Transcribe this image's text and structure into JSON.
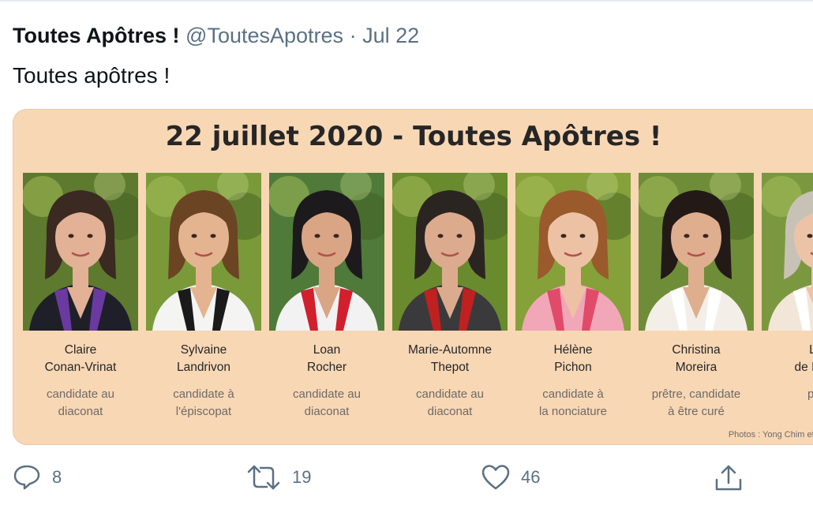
{
  "tweet": {
    "author_name": "Toutes Apôtres !",
    "author_handle": "@ToutesApotres",
    "separator": "·",
    "date": "Jul 22",
    "text": "Toutes apôtres !"
  },
  "card": {
    "title": "22 juillet 2020 - Toutes Apôtres !",
    "photo_credit": "Photos : Yong Chim et Lo",
    "people": [
      {
        "name": "Claire\nConan-Vrinat",
        "role": "candidate au\ndiaconat",
        "hair": "#3a2a22",
        "skin": "#e2b196",
        "shirt": "#1f1f2a",
        "accent": "#6a3aa0",
        "bg": "#5e7a2e"
      },
      {
        "name": "Sylvaine\nLandrivon",
        "role": "candidate à\nl'épiscopat",
        "hair": "#6b4424",
        "skin": "#e3b48f",
        "shirt": "#f4f4f2",
        "accent": "#1a1a1a",
        "bg": "#7a9a3a"
      },
      {
        "name": "Loan\nRocher",
        "role": "candidate au\ndiaconat",
        "hair": "#1c1a1c",
        "skin": "#d9a585",
        "shirt": "#f2f2f2",
        "accent": "#d21f2e",
        "bg": "#4f7a3a"
      },
      {
        "name": "Marie-Automne\nThepot",
        "role": "candidate au\ndiaconat",
        "hair": "#2b2522",
        "skin": "#dcab8e",
        "shirt": "#3a3a3c",
        "accent": "#c02020",
        "bg": "#6a8a2e"
      },
      {
        "name": "Hélène\nPichon",
        "role": "candidate à\nla nonciature",
        "hair": "#9a5a2c",
        "skin": "#edc2a4",
        "shirt": "#f2a7b8",
        "accent": "#e24a6a",
        "bg": "#86a03a"
      },
      {
        "name": "Christina\nMoreira",
        "role": "prêtre, candidate\nà être curé",
        "hair": "#231a18",
        "skin": "#dfae8e",
        "shirt": "#f3efe8",
        "accent": "#ffffff",
        "bg": "#6f8d38"
      },
      {
        "name": "Lau\nde Bourb",
        "role": "préd\nla",
        "hair": "#c8c2b6",
        "skin": "#ecc3a6",
        "shirt": "#f1e6d8",
        "accent": "#ffffff",
        "bg": "#7b9840"
      }
    ]
  },
  "actions": {
    "reply_count": "8",
    "retweet_count": "19",
    "like_count": "46",
    "icons": [
      "reply-icon",
      "retweet-icon",
      "like-icon",
      "share-icon"
    ]
  }
}
